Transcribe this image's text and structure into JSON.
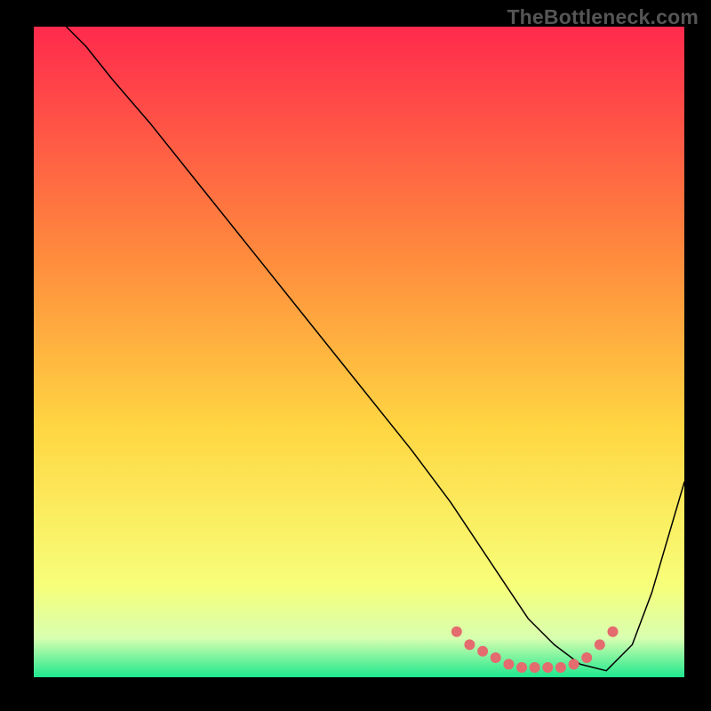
{
  "watermark": "TheBottleneck.com",
  "chart_data": {
    "type": "line",
    "title": "",
    "xlabel": "",
    "ylabel": "",
    "xlim": [
      0,
      100
    ],
    "ylim": [
      0,
      100
    ],
    "grid": false,
    "legend": false,
    "background_gradient": {
      "top": "#ff2a4d",
      "mid1": "#ff8a3d",
      "mid2": "#ffd742",
      "mid3": "#f7ff7a",
      "bottom": "#1ee88e"
    },
    "series": [
      {
        "name": "curve",
        "color": "#000000",
        "width": 1.5,
        "x": [
          5,
          8,
          12,
          18,
          26,
          34,
          42,
          50,
          58,
          64,
          68,
          72,
          76,
          80,
          84,
          88,
          92,
          95,
          100
        ],
        "y": [
          100,
          97,
          92,
          85,
          75,
          65,
          55,
          45,
          35,
          27,
          21,
          15,
          9,
          5,
          2,
          1,
          5,
          13,
          30
        ]
      }
    ],
    "dotted_segment": {
      "name": "dotted-bottom",
      "color": "#e46b6e",
      "radius": 6,
      "x": [
        65,
        67,
        69,
        71,
        73,
        75,
        77,
        79,
        81,
        83,
        85,
        87,
        89
      ],
      "y": [
        7,
        5,
        4,
        3,
        2,
        1.5,
        1.5,
        1.5,
        1.5,
        2,
        3,
        5,
        7
      ]
    }
  }
}
